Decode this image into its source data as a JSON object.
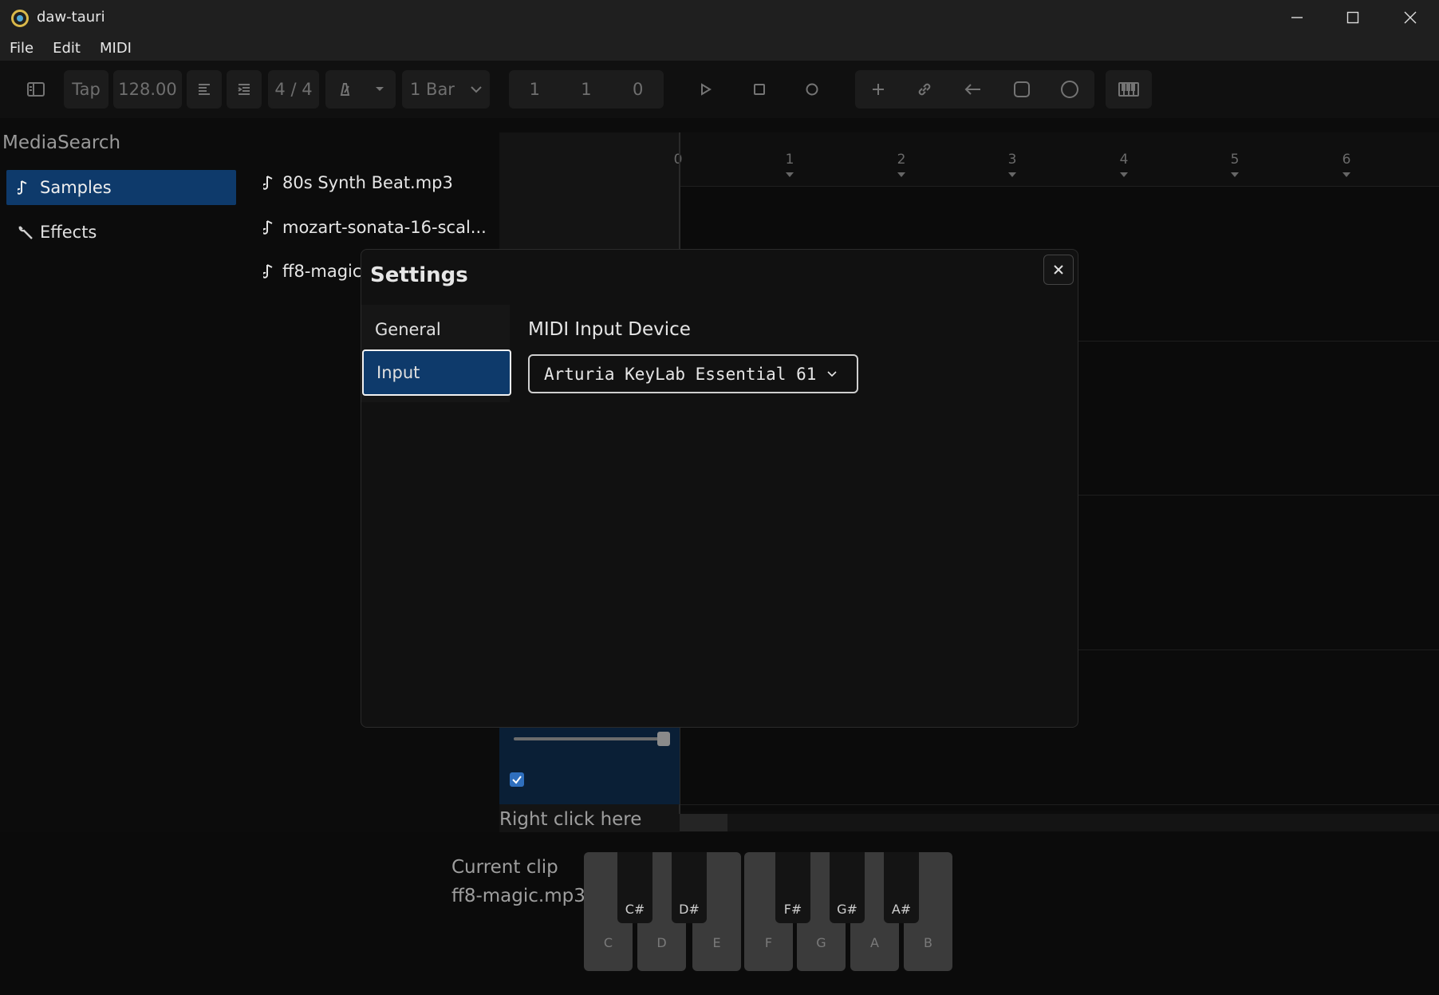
{
  "window": {
    "title": "daw-tauri"
  },
  "menu": [
    "File",
    "Edit",
    "MIDI"
  ],
  "toolbar": {
    "tap_label": "Tap",
    "bpm": "128.00",
    "time_signature": "4 / 4",
    "snap": "1 Bar",
    "position": {
      "bar": "1",
      "beat": "1",
      "tick": "0"
    }
  },
  "sidebar": {
    "title": "MediaSearch",
    "items": [
      {
        "label": "Samples",
        "icon": "music-note-icon",
        "active": true
      },
      {
        "label": "Effects",
        "icon": "wrench-icon",
        "active": false
      }
    ]
  },
  "samples": [
    "80s Synth Beat.mp3",
    "mozart-sonata-16-scal...",
    "ff8-magic.mp3"
  ],
  "ruler": [
    "0",
    "1",
    "2",
    "3",
    "4",
    "5",
    "6"
  ],
  "track": {
    "hint": "Right click here",
    "volume": 0.97,
    "checked": true
  },
  "current_clip": {
    "label": "Current clip",
    "value": "ff8-magic.mp3"
  },
  "piano": {
    "white_keys": [
      "C",
      "D",
      "E",
      "F",
      "G",
      "A",
      "B"
    ],
    "black_keys": [
      "C#",
      "D#",
      "F#",
      "G#",
      "A#"
    ]
  },
  "settings": {
    "title": "Settings",
    "nav": [
      {
        "label": "General",
        "active": false
      },
      {
        "label": "Input",
        "active": true
      }
    ],
    "field_label": "MIDI Input Device",
    "device_value": "Arturia KeyLab Essential 61"
  },
  "colors": {
    "accent": "#0e3a6b",
    "background": "#0c0c0c"
  }
}
